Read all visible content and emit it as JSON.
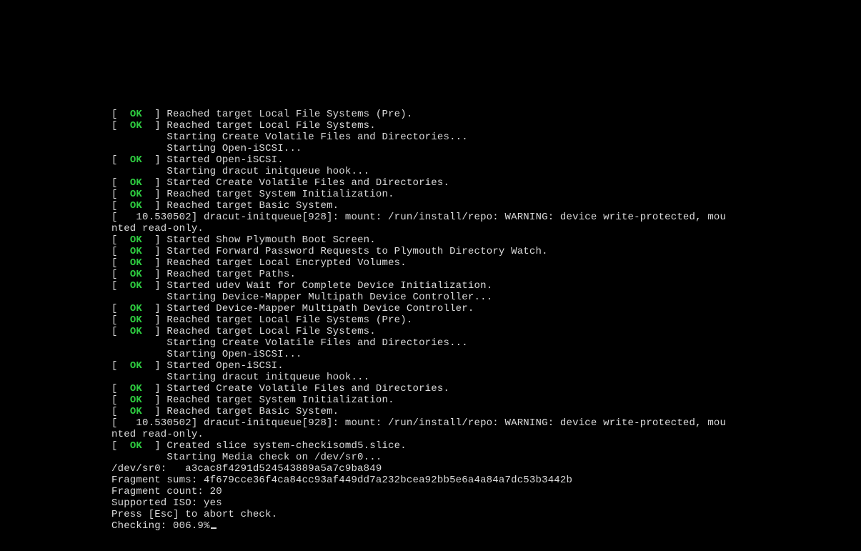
{
  "ok_label": "OK",
  "lines": [
    {
      "type": "ok",
      "text": "Reached target Local File Systems (Pre)."
    },
    {
      "type": "ok",
      "text": "Reached target Local File Systems."
    },
    {
      "type": "start",
      "text": "Starting Create Volatile Files and Directories..."
    },
    {
      "type": "start",
      "text": "Starting Open-iSCSI..."
    },
    {
      "type": "ok",
      "text": "Started Open-iSCSI."
    },
    {
      "type": "start",
      "text": "Starting dracut initqueue hook..."
    },
    {
      "type": "ok",
      "text": "Started Create Volatile Files and Directories."
    },
    {
      "type": "ok",
      "text": "Reached target System Initialization."
    },
    {
      "type": "ok",
      "text": "Reached target Basic System."
    },
    {
      "type": "plain",
      "text": "[   10.530502] dracut-initqueue[928]: mount: /run/install/repo: WARNING: device write-protected, mou"
    },
    {
      "type": "plain",
      "text": "nted read-only."
    },
    {
      "type": "ok",
      "text": "Started Show Plymouth Boot Screen."
    },
    {
      "type": "ok",
      "text": "Started Forward Password Requests to Plymouth Directory Watch."
    },
    {
      "type": "ok",
      "text": "Reached target Local Encrypted Volumes."
    },
    {
      "type": "ok",
      "text": "Reached target Paths."
    },
    {
      "type": "ok",
      "text": "Started udev Wait for Complete Device Initialization."
    },
    {
      "type": "start",
      "text": "Starting Device-Mapper Multipath Device Controller..."
    },
    {
      "type": "ok",
      "text": "Started Device-Mapper Multipath Device Controller."
    },
    {
      "type": "ok",
      "text": "Reached target Local File Systems (Pre)."
    },
    {
      "type": "ok",
      "text": "Reached target Local File Systems."
    },
    {
      "type": "start",
      "text": "Starting Create Volatile Files and Directories..."
    },
    {
      "type": "start",
      "text": "Starting Open-iSCSI..."
    },
    {
      "type": "ok",
      "text": "Started Open-iSCSI."
    },
    {
      "type": "start",
      "text": "Starting dracut initqueue hook..."
    },
    {
      "type": "ok",
      "text": "Started Create Volatile Files and Directories."
    },
    {
      "type": "ok",
      "text": "Reached target System Initialization."
    },
    {
      "type": "ok",
      "text": "Reached target Basic System."
    },
    {
      "type": "plain",
      "text": "[   10.530502] dracut-initqueue[928]: mount: /run/install/repo: WARNING: device write-protected, mou"
    },
    {
      "type": "plain",
      "text": "nted read-only."
    },
    {
      "type": "ok",
      "text": "Created slice system-checkisomd5.slice."
    },
    {
      "type": "start",
      "text": "Starting Media check on /dev/sr0..."
    },
    {
      "type": "plain",
      "text": "/dev/sr0:   a3cac8f4291d524543889a5a7c9ba849"
    },
    {
      "type": "plain",
      "text": "Fragment sums: 4f679cce36f4ca84cc93af449dd7a232bcea92bb5e6a4a84a7dc53b3442b"
    },
    {
      "type": "plain",
      "text": "Fragment count: 20"
    },
    {
      "type": "plain",
      "text": "Supported ISO: yes"
    },
    {
      "type": "plain",
      "text": "Press [Esc] to abort check."
    },
    {
      "type": "plain",
      "text": "Checking: 006.9%",
      "cursor": true
    }
  ]
}
